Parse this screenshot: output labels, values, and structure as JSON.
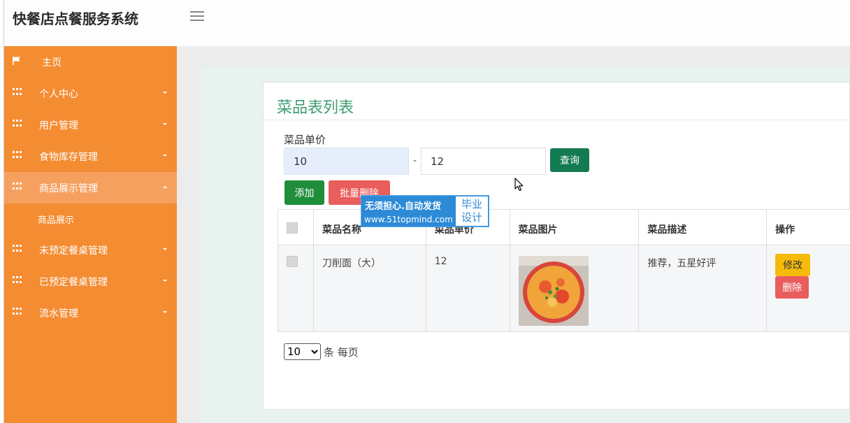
{
  "app": {
    "title": "快餐店点餐服务系统"
  },
  "sidebar": {
    "items": [
      {
        "label": "主页",
        "icon": "flag-icon"
      },
      {
        "label": "个人中心",
        "icon": "grid-icon"
      },
      {
        "label": "用户管理",
        "icon": "grid-icon"
      },
      {
        "label": "食物库存管理",
        "icon": "grid-icon"
      },
      {
        "label": "商品展示管理",
        "icon": "grid-icon",
        "expanded": true
      },
      {
        "label": "未预定餐桌管理",
        "icon": "grid-icon"
      },
      {
        "label": "已预定餐桌管理",
        "icon": "grid-icon"
      },
      {
        "label": "流水管理",
        "icon": "grid-icon"
      }
    ],
    "submenu": {
      "label": "商品展示"
    }
  },
  "panel": {
    "title": "菜品表列表",
    "filter": {
      "label": "菜品单价",
      "min_value": "10",
      "max_value": "12",
      "separator": "-",
      "query_label": "查询"
    },
    "actions": {
      "add_label": "添加",
      "batch_delete_label": "批量删除"
    },
    "table": {
      "headers": [
        "菜品名称",
        "菜品单价",
        "菜品图片",
        "菜品描述",
        "操作"
      ],
      "rows": [
        {
          "name": "刀削面（大）",
          "price": "12",
          "description": "推荐，五星好评",
          "edit_label": "修改",
          "delete_label": "删除"
        }
      ]
    },
    "pagination": {
      "page_size": "10",
      "options": [
        "10"
      ],
      "suffix": "条 每页"
    }
  },
  "watermark": {
    "line1": "无须担心.自动发货",
    "line2": "www.51topmind.com",
    "badge_line1": "毕业",
    "badge_line2": "设计"
  },
  "colors": {
    "sidebar": "#f48c32",
    "sidebar_active": "#f6a060",
    "title_green": "#3e9c72",
    "query_button": "#147a52",
    "add_button": "#1f8d3a",
    "delete_button": "#e95d5d",
    "edit_button": "#f5bb0b"
  }
}
